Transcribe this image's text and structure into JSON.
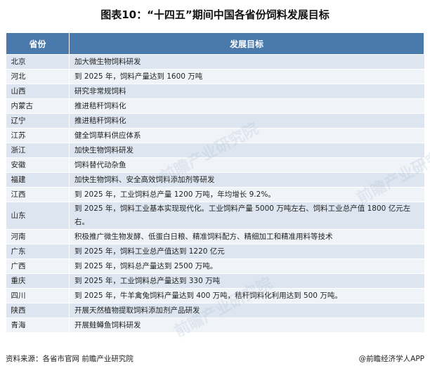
{
  "title": "图表10：“十四五”期间中国各省份饲料发展目标",
  "table": {
    "headers": [
      "省份",
      "发展目标"
    ],
    "rows": [
      {
        "province": "北京",
        "goal": "加大微生物饲料研发"
      },
      {
        "province": "河北",
        "goal": "到 2025 年，饲料产量达到 1600 万吨"
      },
      {
        "province": "山西",
        "goal": "研究非常规饲料"
      },
      {
        "province": "内蒙古",
        "goal": "推进秸秆饲料化"
      },
      {
        "province": "辽宁",
        "goal": "推进秸秆饲料化"
      },
      {
        "province": "江苏",
        "goal": "健全饲草料供应体系"
      },
      {
        "province": "浙江",
        "goal": "加快生物饲料研发"
      },
      {
        "province": "安徽",
        "goal": "饲料替代动杂鱼"
      },
      {
        "province": "福建",
        "goal": "加快生物饲料、安全高效饲料添加剂等研发"
      },
      {
        "province": "江西",
        "goal": "到 2025 年，工业饲料总产量 1200 万吨，年均增长 9.2%。"
      },
      {
        "province": "山东",
        "goal": "到 2025 年，饲料工业基本实现现代化。工业饲料产量 5000 万吨左右、饲料工业总产值 1800 亿元左右。"
      },
      {
        "province": "河南",
        "goal": "积极推广微生物发酵、低蛋白日粮、精准饲料配方、精细加工和精准用料等技术"
      },
      {
        "province": "广东",
        "goal": "到 2025 年，饲料工业总产值达到 1220 亿元"
      },
      {
        "province": "广西",
        "goal": "到 2025 年，饲料总产量达到 2500 万吨。"
      },
      {
        "province": "重庆",
        "goal": "到 2025 年，工业饲料总产量达到 330 万吨"
      },
      {
        "province": "四川",
        "goal": "到 2025 年，牛羊禽兔饲料产量达到 400 万吨，秸秆饲料化利用达到 500 万吨。"
      },
      {
        "province": "陕西",
        "goal": "开展天然植物提取饲料添加剂产品研发"
      },
      {
        "province": "青海",
        "goal": "开展鲑鳟鱼饲料研发"
      }
    ]
  },
  "footer": {
    "source": "资料来源：各省市官网 前瞻产业研究院",
    "brand": "@前瞻经济学人APP"
  },
  "watermark": "前瞻产业研究院"
}
